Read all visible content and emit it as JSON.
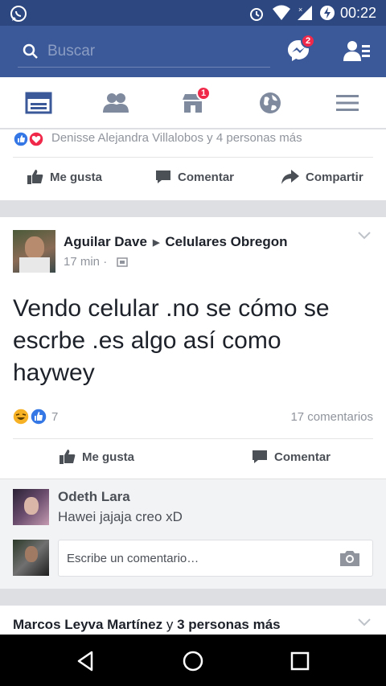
{
  "status_bar": {
    "time": "00:22"
  },
  "header": {
    "search_placeholder": "Buscar",
    "messenger_badge": "2"
  },
  "tabs": {
    "marketplace_badge": "1"
  },
  "prev_post": {
    "reactions_text": "Denisse Alejandra Villalobos y 4 personas más",
    "like_label": "Me gusta",
    "comment_label": "Comentar",
    "share_label": "Compartir"
  },
  "post": {
    "author": "Aguilar Dave",
    "group": "Celulares Obregon",
    "time": "17 min ·",
    "text_lines": [
      "Vendo celular .no se cómo se",
      "escrbe .es algo así como",
      "haywey"
    ],
    "reaction_count": "7",
    "comments_count": "17 comentarios",
    "like_label": "Me gusta",
    "comment_label": "Comentar"
  },
  "comment": {
    "author": "Odeth Lara",
    "text": "Hawei jajaja creo xD"
  },
  "composer": {
    "placeholder": "Escribe un comentario…"
  },
  "next_post": {
    "author": "Marcos Leyva Martínez",
    "connector": "y",
    "others": "3 personas más"
  },
  "colors": {
    "brand": "#3b5998",
    "status": "#2d4780",
    "badge": "#f02849"
  }
}
